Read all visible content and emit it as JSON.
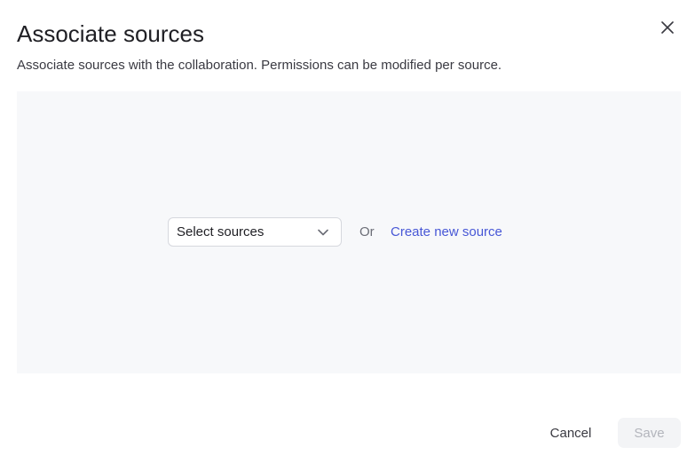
{
  "dialog": {
    "title": "Associate sources",
    "subtitle": "Associate sources with the collaboration. Permissions can be modified per source.",
    "close_icon": "close-icon"
  },
  "panel": {
    "select": {
      "label": "Select sources",
      "icon": "chevron-down-icon"
    },
    "or_text": "Or",
    "create_link": "Create new source",
    "link_color": "#4757d6",
    "background": "#f7f8fa"
  },
  "footer": {
    "cancel_label": "Cancel",
    "save_label": "Save",
    "save_disabled": true
  }
}
